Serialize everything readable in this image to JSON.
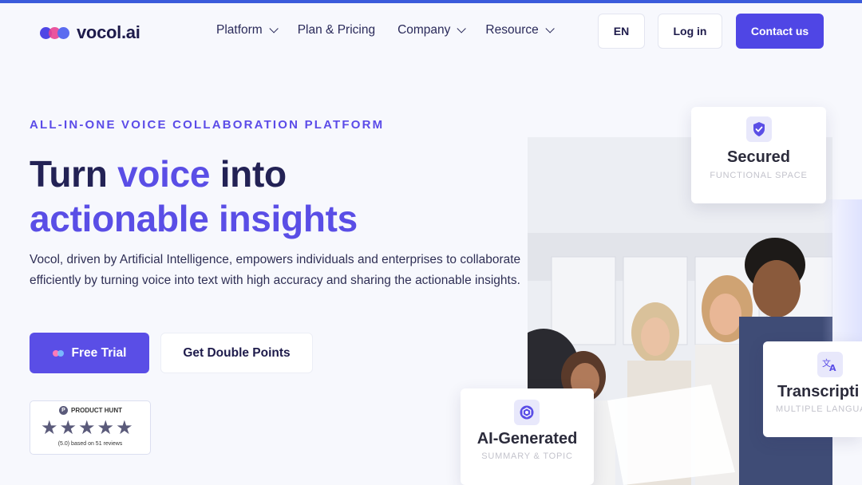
{
  "brand": {
    "name": "vocol.ai"
  },
  "nav": {
    "items": [
      {
        "label": "Platform",
        "has_dropdown": true
      },
      {
        "label": "Plan & Pricing",
        "has_dropdown": false
      },
      {
        "label": "Company",
        "has_dropdown": true
      },
      {
        "label": "Resource",
        "has_dropdown": true
      }
    ],
    "language_label": "EN",
    "login_label": "Log in",
    "contact_label": "Contact us"
  },
  "hero": {
    "eyebrow": "ALL-IN-ONE VOICE COLLABORATION PLATFORM",
    "headline_part1": "Turn ",
    "headline_accent1": "voice",
    "headline_part2": " into",
    "headline_accent2": "actionable insights",
    "description": "Vocol, driven by Artificial Intelligence, empowers individuals and enterprises to collaborate efficiently by turning voice into text with high accuracy and sharing the actionable insights.",
    "primary_cta": "Free Trial",
    "secondary_cta": "Get Double Points"
  },
  "product_hunt": {
    "label": "PRODUCT HUNT",
    "logo_letter": "P",
    "stars": "★★★★★",
    "rating": 5.0,
    "review_text": "(5.0) based on 51 reviews"
  },
  "feature_cards": [
    {
      "title": "Secured",
      "subtitle": "FUNCTIONAL SPACE",
      "icon": "shield-check-icon"
    },
    {
      "title": "AI-Generated",
      "subtitle": "SUMMARY & TOPIC",
      "icon": "ai-chip-icon"
    },
    {
      "title": "Transcripti",
      "subtitle": "MULTIPLE LANGUA",
      "icon": "translate-icon"
    }
  ],
  "colors": {
    "primary": "#5a4ee6",
    "contact_button": "#4f46e5",
    "heading": "#232255",
    "top_bar": "#3b5bdb"
  }
}
